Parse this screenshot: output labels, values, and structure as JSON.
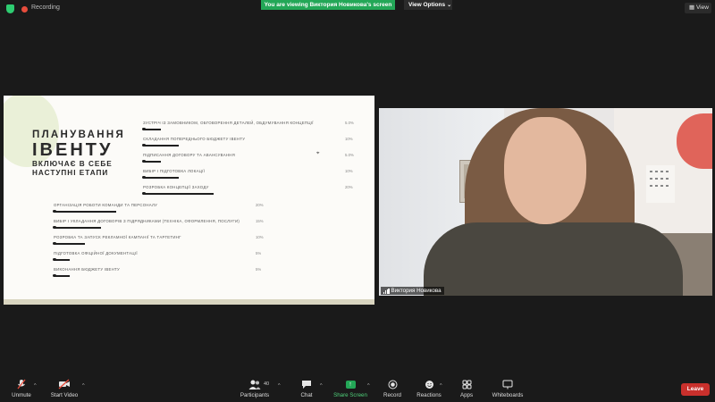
{
  "topbar": {
    "recording_label": "Recording",
    "viewing_banner": "You are viewing Виктория Новикова's screen",
    "view_options_label": "View Options",
    "view_button_label": "View"
  },
  "slide": {
    "title_line1": "ПЛАНУВАННЯ",
    "title_line2": "ІВЕНТУ",
    "title_line3a": "ВКЛЮЧАЄ В СЕБЕ",
    "title_line3b": "НАСТУПНІ ЕТАПИ",
    "steps": [
      {
        "label": "ЗУСТРІЧ ІЗ ЗАМОВНИКОМ, ОБГОВОРЕННЯ ДЕТАЛЕЙ, ОБДУМУВАННЯ КОНЦЕПЦІЇ",
        "percent": "5.0%",
        "fill": 0.05
      },
      {
        "label": "СКЛАДАННЯ ПОПЕРЕДНЬОГО БЮДЖЕТУ ІВЕНТУ",
        "percent": "10%",
        "fill": 0.1
      },
      {
        "label": "ПІДПИСАННЯ ДОГОВОРУ ТА АВАНСУВАННЯ",
        "percent": "5.0%",
        "fill": 0.05
      },
      {
        "label": "ВИБІР І ПІДГОТОВКА ЛОКАЦІЇ",
        "percent": "10%",
        "fill": 0.1
      },
      {
        "label": "РОЗРОБКА КОНЦЕПЦІЇ ЗАХОДУ",
        "percent": "20%",
        "fill": 0.2
      },
      {
        "label": "ОРГАНІЗАЦІЯ РОБОТИ КОМАНДИ ТА ПЕРСОНАЛУ",
        "percent": "20%",
        "fill": 0.2
      },
      {
        "label": "ВИБІР І УКЛАДАННЯ ДОГОВОРІВ З ПІДРЯДНИКАМИ (ТЕХНІКА, ОФОРМЛЕННЯ, ПОСЛУГИ)",
        "percent": "15%",
        "fill": 0.15
      },
      {
        "label": "РОЗРОБКА ТА ЗАПУСК РЕКЛАМНОЇ КАМПАНІЇ ТА ТАРГЕТИНГ",
        "percent": "10%",
        "fill": 0.1
      },
      {
        "label": "ПІДГОТОВКА ОФІЦІЙНОЇ ДОКУМЕНТАЦІЇ",
        "percent": "5%",
        "fill": 0.05
      },
      {
        "label": "ВИКОНАННЯ БЮДЖЕТУ ІВЕНТУ",
        "percent": "5%",
        "fill": 0.05
      }
    ]
  },
  "video": {
    "participant_name": "Виктория Новикова"
  },
  "toolbar": {
    "unmute_label": "Unmute",
    "start_video_label": "Start Video",
    "participants_label": "Participants",
    "participants_count": "40",
    "chat_label": "Chat",
    "share_screen_label": "Share Screen",
    "record_label": "Record",
    "reactions_label": "Reactions",
    "apps_label": "Apps",
    "whiteboards_label": "Whiteboards",
    "leave_label": "Leave"
  },
  "colors": {
    "accent_green": "#23a757",
    "leave_red": "#c9302c",
    "background": "#1a1a1a"
  }
}
